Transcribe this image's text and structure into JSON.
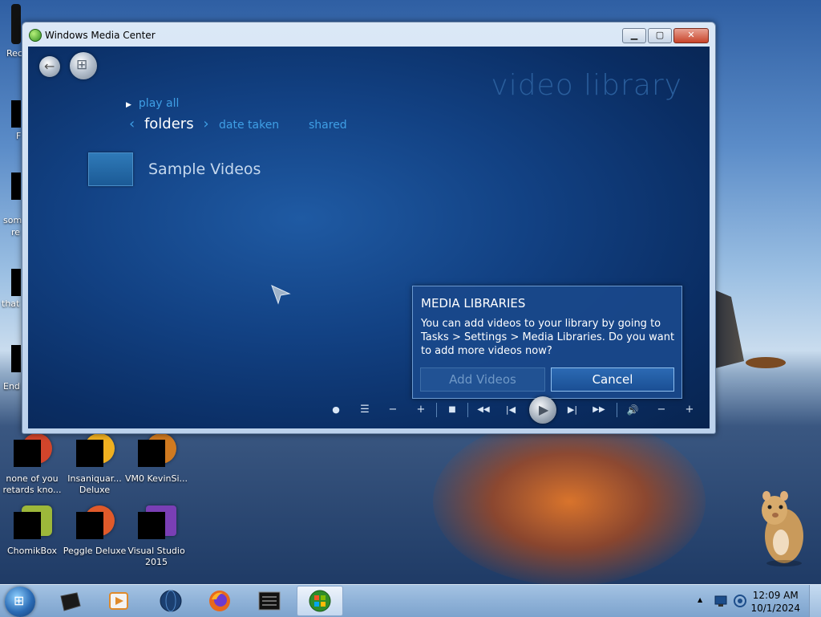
{
  "window": {
    "title": "Windows Media Center",
    "buttons": {
      "minimize": "▁",
      "maximize": "▢",
      "close": "✕"
    }
  },
  "wmc": {
    "page_title": "video library",
    "play_all": "play all",
    "nav": {
      "prev_chev": "‹",
      "current": "folders",
      "next_chev": "›",
      "items": [
        "date taken",
        "shared"
      ]
    },
    "folder_label": "Sample Videos"
  },
  "dialog": {
    "title": "MEDIA LIBRARIES",
    "message": "You can add videos to your library by going to Tasks > Settings > Media Libraries. Do you want to add more videos now?",
    "add_button": "Add Videos",
    "cancel_button": "Cancel"
  },
  "transport": {
    "record": "●",
    "guide": "☰",
    "channel_down": "−",
    "channel_up": "+",
    "stop": "■",
    "rewind": "◀◀",
    "prev": "|◀",
    "play": "▶",
    "next": "▶|",
    "fast_forward": "▶▶",
    "mute": "🔊",
    "vol_down": "−",
    "vol_up": "+"
  },
  "desktop": {
    "edge_labels": [
      "Rec",
      "F",
      "som",
      "re",
      "that",
      "End"
    ],
    "icons": [
      {
        "label": "none of you retards kno...",
        "color": "#d2452b"
      },
      {
        "label": "Insaniquar... Deluxe",
        "color": "#f0b020"
      },
      {
        "label": "VM0 KevinSi...",
        "color": "#d07a20"
      },
      {
        "label": "ChomikBox",
        "color": "#9db83a"
      },
      {
        "label": "Peggle Deluxe",
        "color": "#e05a2a"
      },
      {
        "label": "Visual Studio 2015",
        "color": "#7a3fb5"
      }
    ]
  },
  "taskbar": {
    "clock_time": "12:09 AM",
    "clock_date": "10/1/2024",
    "tray_chevron": "▲"
  }
}
